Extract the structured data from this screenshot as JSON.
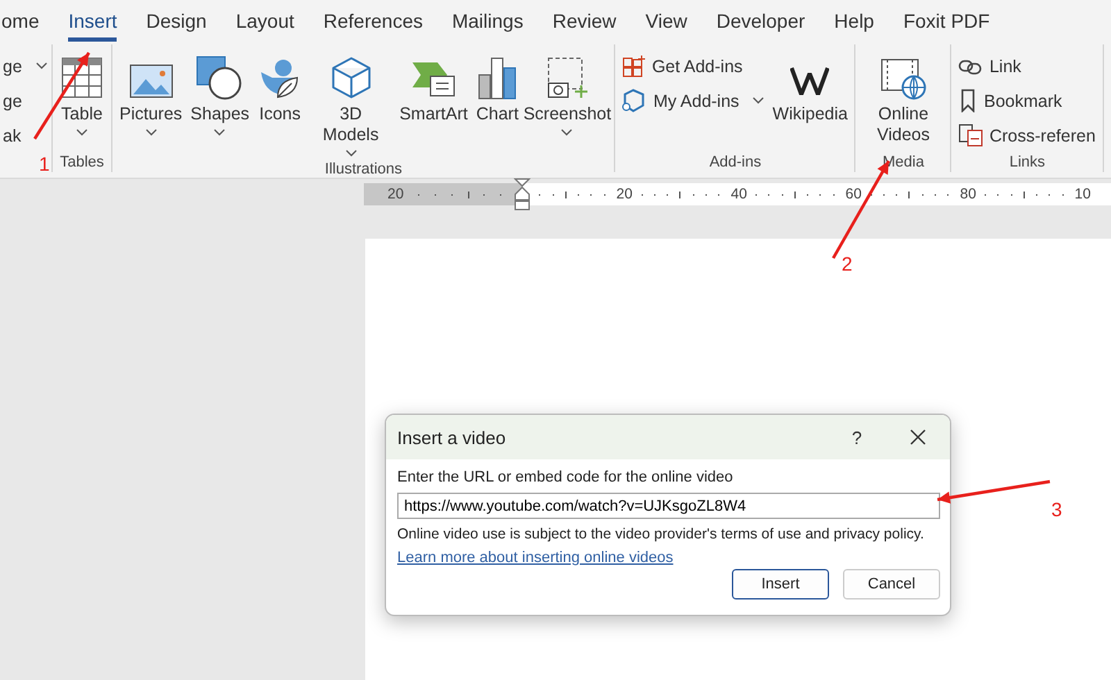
{
  "tabs": [
    {
      "label": "ome",
      "selected": false
    },
    {
      "label": "Insert",
      "selected": true
    },
    {
      "label": "Design",
      "selected": false
    },
    {
      "label": "Layout",
      "selected": false
    },
    {
      "label": "References",
      "selected": false
    },
    {
      "label": "Mailings",
      "selected": false
    },
    {
      "label": "Review",
      "selected": false
    },
    {
      "label": "View",
      "selected": false
    },
    {
      "label": "Developer",
      "selected": false
    },
    {
      "label": "Help",
      "selected": false
    },
    {
      "label": "Foxit PDF",
      "selected": false
    }
  ],
  "ribbon": {
    "groups": [
      {
        "items": [
          {
            "kind": "small",
            "label": "ge",
            "dropdown": true
          },
          {
            "kind": "small",
            "label": "ge",
            "dropdown": false
          },
          {
            "kind": "small",
            "label": "ak",
            "dropdown": false
          }
        ]
      },
      {
        "label": "Tables",
        "items": [
          {
            "kind": "large",
            "label": "Table",
            "dropdown": true
          }
        ]
      },
      {
        "label": "Illustrations",
        "items": [
          {
            "kind": "large",
            "label": "Pictures",
            "dropdown": true
          },
          {
            "kind": "large",
            "label": "Shapes",
            "dropdown": true
          },
          {
            "kind": "large",
            "label": "Icons",
            "dropdown": false
          },
          {
            "kind": "large",
            "label": "3D Models",
            "dropdown": true
          },
          {
            "kind": "large",
            "label": "SmartArt",
            "dropdown": false
          },
          {
            "kind": "large",
            "label": "Chart",
            "dropdown": false
          },
          {
            "kind": "large",
            "label": "Screenshot",
            "dropdown": true
          }
        ]
      },
      {
        "label": "Add-ins",
        "items": [
          {
            "kind": "small",
            "label": "Get Add-ins",
            "dropdown": false
          },
          {
            "kind": "small",
            "label": "My Add-ins",
            "dropdown": true
          },
          {
            "kind": "large",
            "label": "Wikipedia",
            "dropdown": false
          }
        ]
      },
      {
        "label": "Media",
        "items": [
          {
            "kind": "large",
            "label": "Online Videos",
            "dropdown": false
          }
        ]
      },
      {
        "label": "Links",
        "items": [
          {
            "kind": "small",
            "label": "Link",
            "dropdown": false
          },
          {
            "kind": "small",
            "label": "Bookmark",
            "dropdown": false
          },
          {
            "kind": "small",
            "label": "Cross-referen",
            "dropdown": false
          }
        ]
      }
    ]
  },
  "ruler": {
    "labels": [
      "20",
      "20",
      "40",
      "60",
      "80",
      "10"
    ]
  },
  "dialog": {
    "title": "Insert a video",
    "help": "?",
    "prompt": "Enter the URL or embed code for the online video",
    "url": "https://www.youtube.com/watch?v=UJKsgoZL8W4",
    "note": "Online video use is subject to the video provider's terms of use and privacy policy.",
    "link": "Learn more about inserting online videos",
    "buttons": [
      {
        "label": "Insert",
        "selected": true
      },
      {
        "label": "Cancel",
        "selected": false
      }
    ]
  },
  "annotations": [
    {
      "label": "1"
    },
    {
      "label": "2"
    },
    {
      "label": "3"
    }
  ]
}
